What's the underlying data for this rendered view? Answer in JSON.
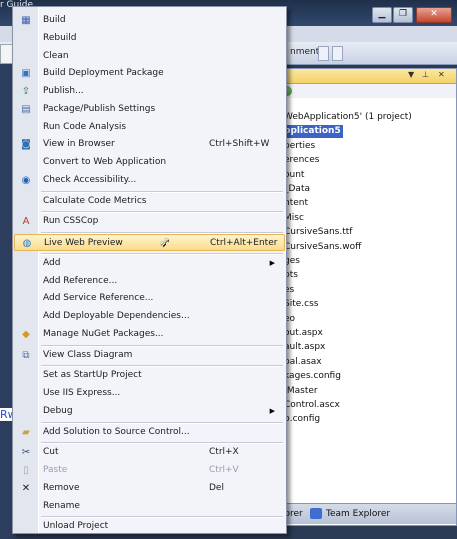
{
  "ide": {
    "title_fragment": "r Guide",
    "toolbar_fragment": "nments",
    "left_label": "Rw",
    "solution_explorer": {
      "items": [
        {
          "label": "WebApplication5' (1 project)"
        },
        {
          "label": "pplication5",
          "selected": true
        },
        {
          "label": "perties"
        },
        {
          "label": "erences"
        },
        {
          "label": "ount"
        },
        {
          "label": "_Data"
        },
        {
          "label": "ntent"
        },
        {
          "label": "Misc"
        },
        {
          "label": "CursiveSans.ttf"
        },
        {
          "label": "CursiveSans.woff"
        },
        {
          "label": "ges"
        },
        {
          "label": "pts"
        },
        {
          "label": "es"
        },
        {
          "label": "Site.css"
        },
        {
          "label": "ео"
        },
        {
          "label": "out.aspx"
        },
        {
          "label": "ault.aspx"
        },
        {
          "label": "bal.asax"
        },
        {
          "label": "kages.config"
        },
        {
          "label": ".Master"
        },
        {
          "label": "Control.ascx"
        },
        {
          "label": "b.config"
        }
      ],
      "footer_tabs": [
        "lorer",
        "Team Explorer"
      ]
    }
  },
  "menu": {
    "items": [
      {
        "type": "item",
        "label": "Build",
        "icon": "build-icon",
        "glyph": "▦",
        "color": "#3a5fae"
      },
      {
        "type": "item",
        "label": "Rebuild"
      },
      {
        "type": "item",
        "label": "Clean"
      },
      {
        "type": "item",
        "label": "Build Deployment Package",
        "icon": "package-icon",
        "glyph": "▣",
        "color": "#3b6fc0"
      },
      {
        "type": "item",
        "label": "Publish...",
        "icon": "publish-icon",
        "glyph": "⇪",
        "color": "#2f7d3a"
      },
      {
        "type": "item",
        "label": "Package/Publish Settings",
        "icon": "settings-icon",
        "glyph": "▤",
        "color": "#4a6ca8"
      },
      {
        "type": "item",
        "label": "Run Code Analysis"
      },
      {
        "type": "item",
        "label": "View in Browser",
        "shortcut": "Ctrl+Shift+W",
        "icon": "browser-icon",
        "glyph": "◙",
        "color": "#2f6fb3"
      },
      {
        "type": "item",
        "label": "Convert to Web Application"
      },
      {
        "type": "item",
        "label": "Check Accessibility...",
        "icon": "accessibility-icon",
        "glyph": "◉",
        "color": "#1f5fbf"
      },
      {
        "type": "sep"
      },
      {
        "type": "item",
        "label": "Calculate Code Metrics"
      },
      {
        "type": "sep"
      },
      {
        "type": "item",
        "label": "Run CSSCop",
        "icon": "csscop-icon",
        "glyph": "A",
        "color": "#c0392b"
      },
      {
        "type": "sep"
      },
      {
        "type": "item",
        "label": "Live Web Preview",
        "shortcut": "Ctrl+Alt+Enter",
        "icon": "globe-icon",
        "glyph": "◍",
        "color": "#2b7bd0",
        "highlighted": true
      },
      {
        "type": "sep"
      },
      {
        "type": "item",
        "label": "Add",
        "submenu": true
      },
      {
        "type": "item",
        "label": "Add Reference..."
      },
      {
        "type": "item",
        "label": "Add Service Reference..."
      },
      {
        "type": "item",
        "label": "Add Deployable Dependencies..."
      },
      {
        "type": "item",
        "label": "Manage NuGet Packages...",
        "icon": "nuget-icon",
        "glyph": "◆",
        "color": "#d39a1e"
      },
      {
        "type": "sep"
      },
      {
        "type": "item",
        "label": "View Class Diagram",
        "icon": "class-diagram-icon",
        "glyph": "⧉",
        "color": "#5470a8"
      },
      {
        "type": "sep"
      },
      {
        "type": "item",
        "label": "Set as StartUp Project"
      },
      {
        "type": "item",
        "label": "Use IIS Express..."
      },
      {
        "type": "item",
        "label": "Debug",
        "submenu": true
      },
      {
        "type": "sep"
      },
      {
        "type": "item",
        "label": "Add Solution to Source Control...",
        "icon": "source-control-icon",
        "glyph": "▰",
        "color": "#c9a43a"
      },
      {
        "type": "sep"
      },
      {
        "type": "item",
        "label": "Cut",
        "shortcut": "Ctrl+X",
        "icon": "cut-icon",
        "glyph": "✂",
        "color": "#3a4a6a"
      },
      {
        "type": "item",
        "label": "Paste",
        "shortcut": "Ctrl+V",
        "icon": "paste-icon",
        "glyph": "▯",
        "color": "#a0a4ad",
        "disabled": true
      },
      {
        "type": "item",
        "label": "Remove",
        "shortcut": "Del",
        "icon": "remove-icon",
        "glyph": "✕",
        "color": "#222222"
      },
      {
        "type": "item",
        "label": "Rename"
      },
      {
        "type": "sep"
      },
      {
        "type": "item",
        "label": "Unload Project"
      }
    ]
  }
}
